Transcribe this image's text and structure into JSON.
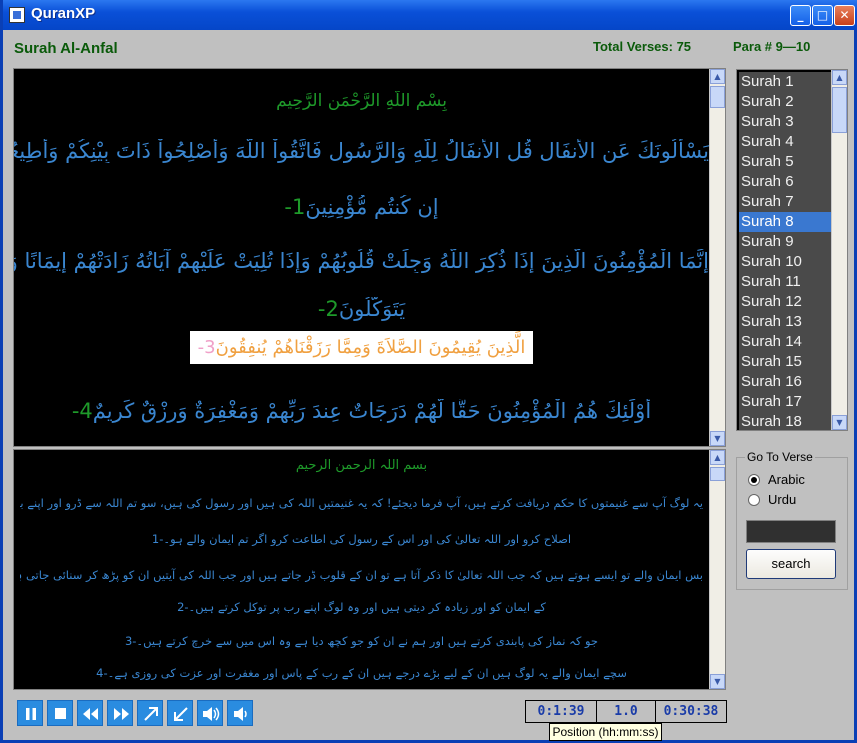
{
  "window": {
    "title": "QuranXP",
    "minimize": "_",
    "maximize": "□",
    "close": "✕"
  },
  "header": {
    "surah_name": "Surah Al-Anfal",
    "total_verses": "Total Verses: 75",
    "para": "Para # 9—10"
  },
  "arabic": {
    "basmala": "بِسْمِ اللّهِ الرَّحْمَنِ الرَّحِيمِ",
    "verses": [
      {
        "text": "يَسْأَلُونَكَ عَنِ الأَنفَالِ قُلِ الأَنفَالُ لِلّهِ وَالرَّسُولِ فَاتَّقُواْ اللّهَ وَأَصْلِحُواْ ذَاتَ بِيْنِكُمْ وَأَطِيعُواْ اللّهَ وَرَسُولَهُ",
        "cont": "إِن كُنتُم مُّؤْمِنِينَ",
        "num": "1-"
      },
      {
        "text": "إِنَّمَا الْمُؤْمِنُونَ الَّذِينَ إِذَا ذُكِرَ اللّهُ وَجِلَتْ قُلُوبُهُمْ وَإِذَا تُلِيَتْ عَلَيْهِمْ آيَاتُهُ زَادَتْهُمْ إِيمَانًا وَعَلَى رَبِّهِمْ",
        "cont": "يَتَوَكَّلُونَ",
        "num": "2-"
      },
      {
        "text": "الَّذِينَ يُقِيمُونَ الصَّلاَةَ وَمِمَّا رَزَقْنَاهُمْ يُنفِقُونَ",
        "num": "3-"
      },
      {
        "text": "أُوْلَئِكَ هُمُ الْمُؤْمِنُونَ حَقًّا لَّهُمْ دَرَجَاتٌ عِندَ رَبِّهِمْ وَمَغْفِرَةٌ وَرِزْقٌ كَرِيمٌ",
        "num": "4-"
      }
    ]
  },
  "urdu": {
    "basmala": "بسم اللہ الرحمن الرحیم",
    "lines": [
      "یہ لوگ آپ سے غنیمتوں کا حکم دریافت کرتے ہیں، آپ فرما دیجئے! کہ یہ غنیمتیں اللہ کی ہیں اور رسول کی ہیں، سو تم اللہ سے ڈرو اور اپنے باہمی تعلقات کی",
      "اصلاح کرو اور اللہ تعالیٰ کی اور اس کے رسول کی اطاعت کرو اگر تم ایمان والے ہو۔-1",
      "بس ایمان والے تو ایسے ہوتے ہیں کہ جب اللہ تعالیٰ کا ذکر آتا ہے تو ان کے قلوب ڈر جاتے ہیں اور جب اللہ کی آیتیں ان کو پڑھ کر سنائی جاتی ہیں تو وہ آیتیں ان",
      "کے ایمان کو اور زیادہ کر دیتی ہیں اور وہ لوگ اپنے رب پر توکل کرتے ہیں۔-2",
      "جو کہ نماز کی پابندی کرتے ہیں اور ہم نے ان کو جو کچھ دیا ہے وہ اس میں سے خرچ کرتے ہیں۔-3",
      "سچے ایمان والے یہ لوگ ہیں ان کے لیے بڑے درجے ہیں ان کے رب کے پاس اور مغفرت اور عزت کی روزی ہے۔-4"
    ]
  },
  "surah_list": {
    "items": [
      "Surah 1",
      "Surah 2",
      "Surah 3",
      "Surah 4",
      "Surah 5",
      "Surah 6",
      "Surah 7",
      "Surah 8",
      "Surah 9",
      "Surah 10",
      "Surah 11",
      "Surah 12",
      "Surah 13",
      "Surah 14",
      "Surah 15",
      "Surah 16",
      "Surah 17",
      "Surah 18"
    ],
    "selected_index": 7
  },
  "goto": {
    "caption": "Go To Verse",
    "arabic_label": "Arabic",
    "urdu_label": "Urdu",
    "selected": "Arabic",
    "input_value": "",
    "search_label": "search"
  },
  "controls": [
    "pause-icon",
    "stop-icon",
    "rewind-icon",
    "fast-forward-icon",
    "expand-icon",
    "collapse-icon",
    "volume-up-icon",
    "volume-down-icon"
  ],
  "playback": {
    "position": "0:1:39",
    "rate": "1.0",
    "duration": "0:30:38",
    "tooltip": "Position (hh:mm:ss)"
  },
  "colors": {
    "titlebar": "#0a50d8",
    "header_text": "#0a5a0a",
    "arabic_text": "#3a86d0",
    "verse_number": "#1e9a2a",
    "highlight_text": "#f0a040",
    "list_selected": "#3a78d0",
    "control_button": "#2a8ce0",
    "time_text": "#1a3ca8"
  }
}
